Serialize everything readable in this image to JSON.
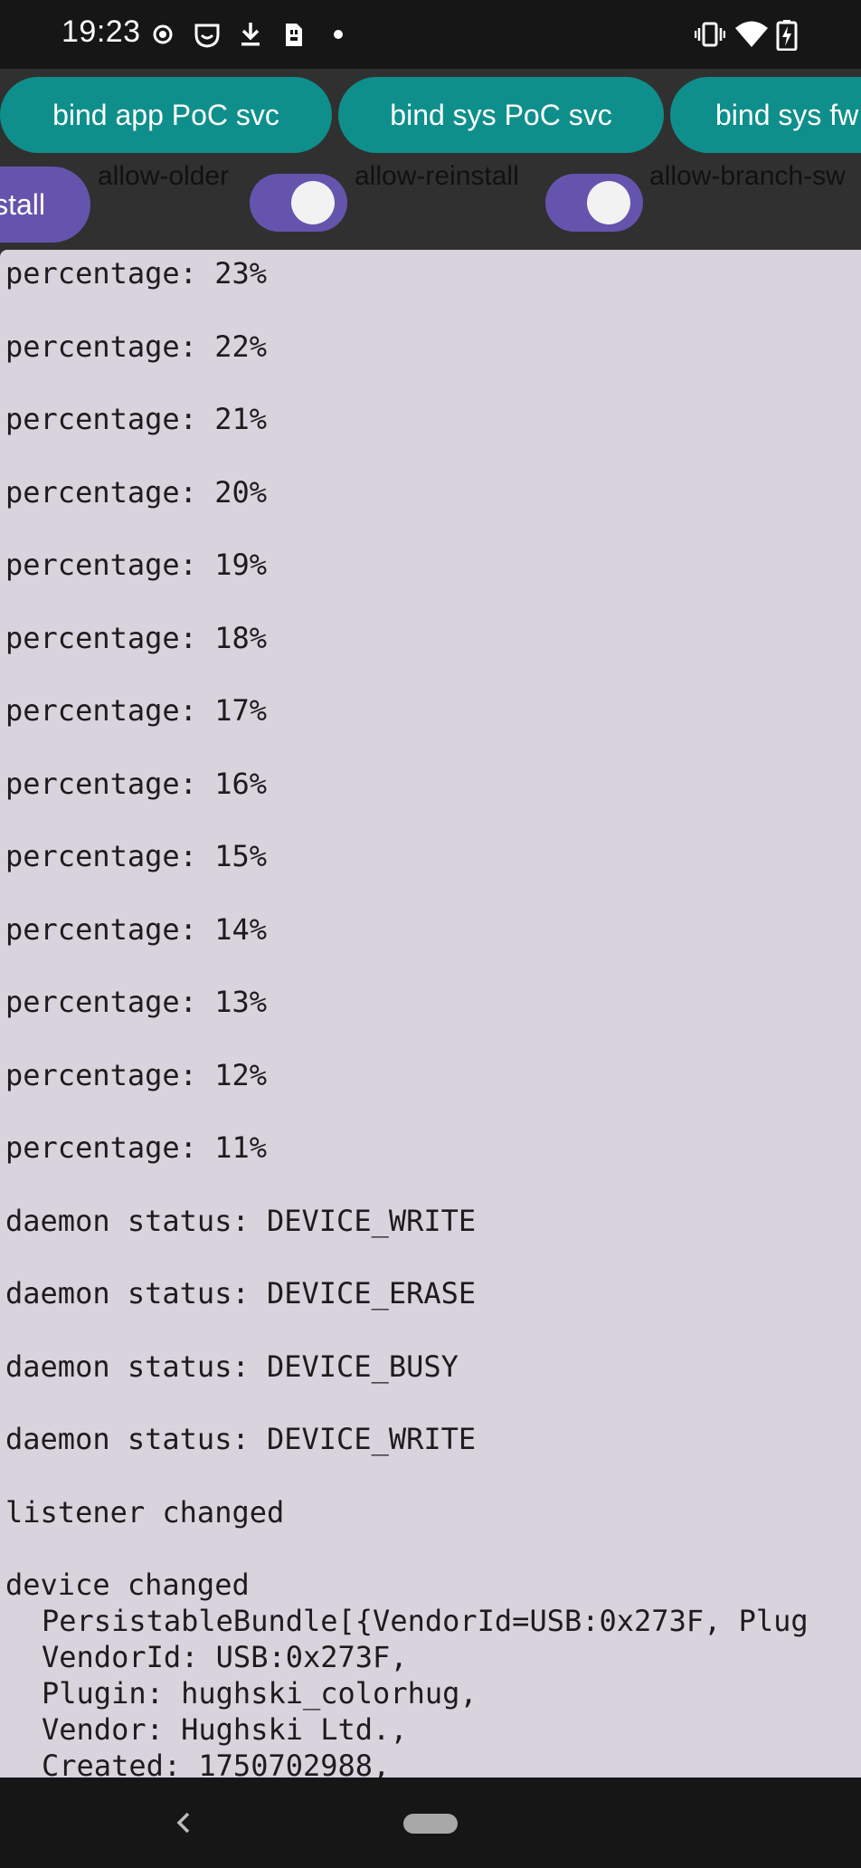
{
  "status_bar": {
    "time": "19:23",
    "left_icons": [
      "target-icon",
      "shield-face-icon",
      "download-icon",
      "sim-card-icon",
      "dot-icon"
    ],
    "right_icons": [
      "vibrate-icon",
      "wifi-icon",
      "battery-charging-icon"
    ]
  },
  "toolbar": {
    "buttons": [
      {
        "label": "bind app PoC svc"
      },
      {
        "label": "bind sys PoC svc"
      },
      {
        "label": "bind sys fw"
      },
      {
        "label": "stall"
      }
    ],
    "options": [
      {
        "label": "allow-older",
        "checked": true
      },
      {
        "label": "allow-reinstall",
        "checked": true
      },
      {
        "label": "allow-branch-sw"
      }
    ],
    "colors": {
      "teal": "#0f8f8b",
      "purple": "#6554ad"
    }
  },
  "log": {
    "entries": [
      "percentage: 23%",
      "percentage: 22%",
      "percentage: 21%",
      "percentage: 20%",
      "percentage: 19%",
      "percentage: 18%",
      "percentage: 17%",
      "percentage: 16%",
      "percentage: 15%",
      "percentage: 14%",
      "percentage: 13%",
      "percentage: 12%",
      "percentage: 11%",
      "daemon status: DEVICE_WRITE",
      "daemon status: DEVICE_ERASE",
      "daemon status: DEVICE_BUSY",
      "daemon status: DEVICE_WRITE",
      "listener changed",
      "device changed"
    ],
    "device_details": [
      "PersistableBundle[{VendorId=USB:0x273F, Plug",
      "VendorId: USB:0x273F,",
      "Plugin: hughski_colorhug,",
      "Vendor: Hughski Ltd.,",
      "Created: 1750702988,"
    ]
  },
  "nav_bar": {
    "icons": [
      "back-icon",
      "home-pill-icon"
    ]
  }
}
